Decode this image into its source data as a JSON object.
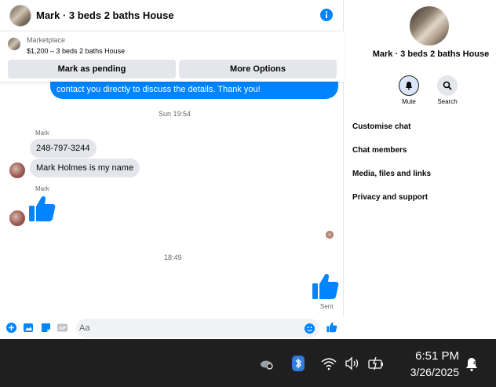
{
  "chat": {
    "header_title": "Mark · 3 beds 2 baths House",
    "marketplace": {
      "label": "Marketplace",
      "listing": "$1,200 – 3 beds 2 baths House",
      "mark_pending_label": "Mark as pending",
      "more_options_label": "More Options"
    },
    "messages": {
      "outgoing_top": "contact you directly to discuss the details. Thank you!",
      "timestamp_1": "Sun 19:54",
      "sender_1": "Mark",
      "msg_phone": "248-797-3244",
      "msg_name": "Mark Holmes is my name",
      "sender_2": "Mark",
      "timestamp_2": "18:49",
      "sent_status": "Sent"
    },
    "composer": {
      "placeholder": "Aa"
    }
  },
  "panel": {
    "title": "Mark · 3 beds 2 baths House",
    "actions": [
      {
        "label": "Mute",
        "icon": "bell-icon"
      },
      {
        "label": "Search",
        "icon": "search-icon"
      }
    ],
    "menu": [
      "Customise chat",
      "Chat members",
      "Media, files and links",
      "Privacy and support"
    ]
  },
  "taskbar": {
    "time": "6:51 PM",
    "date": "3/26/2025"
  },
  "colors": {
    "accent": "#0084ff",
    "bubble_gray": "#e4e6eb",
    "taskbar": "#1f1f1f"
  }
}
